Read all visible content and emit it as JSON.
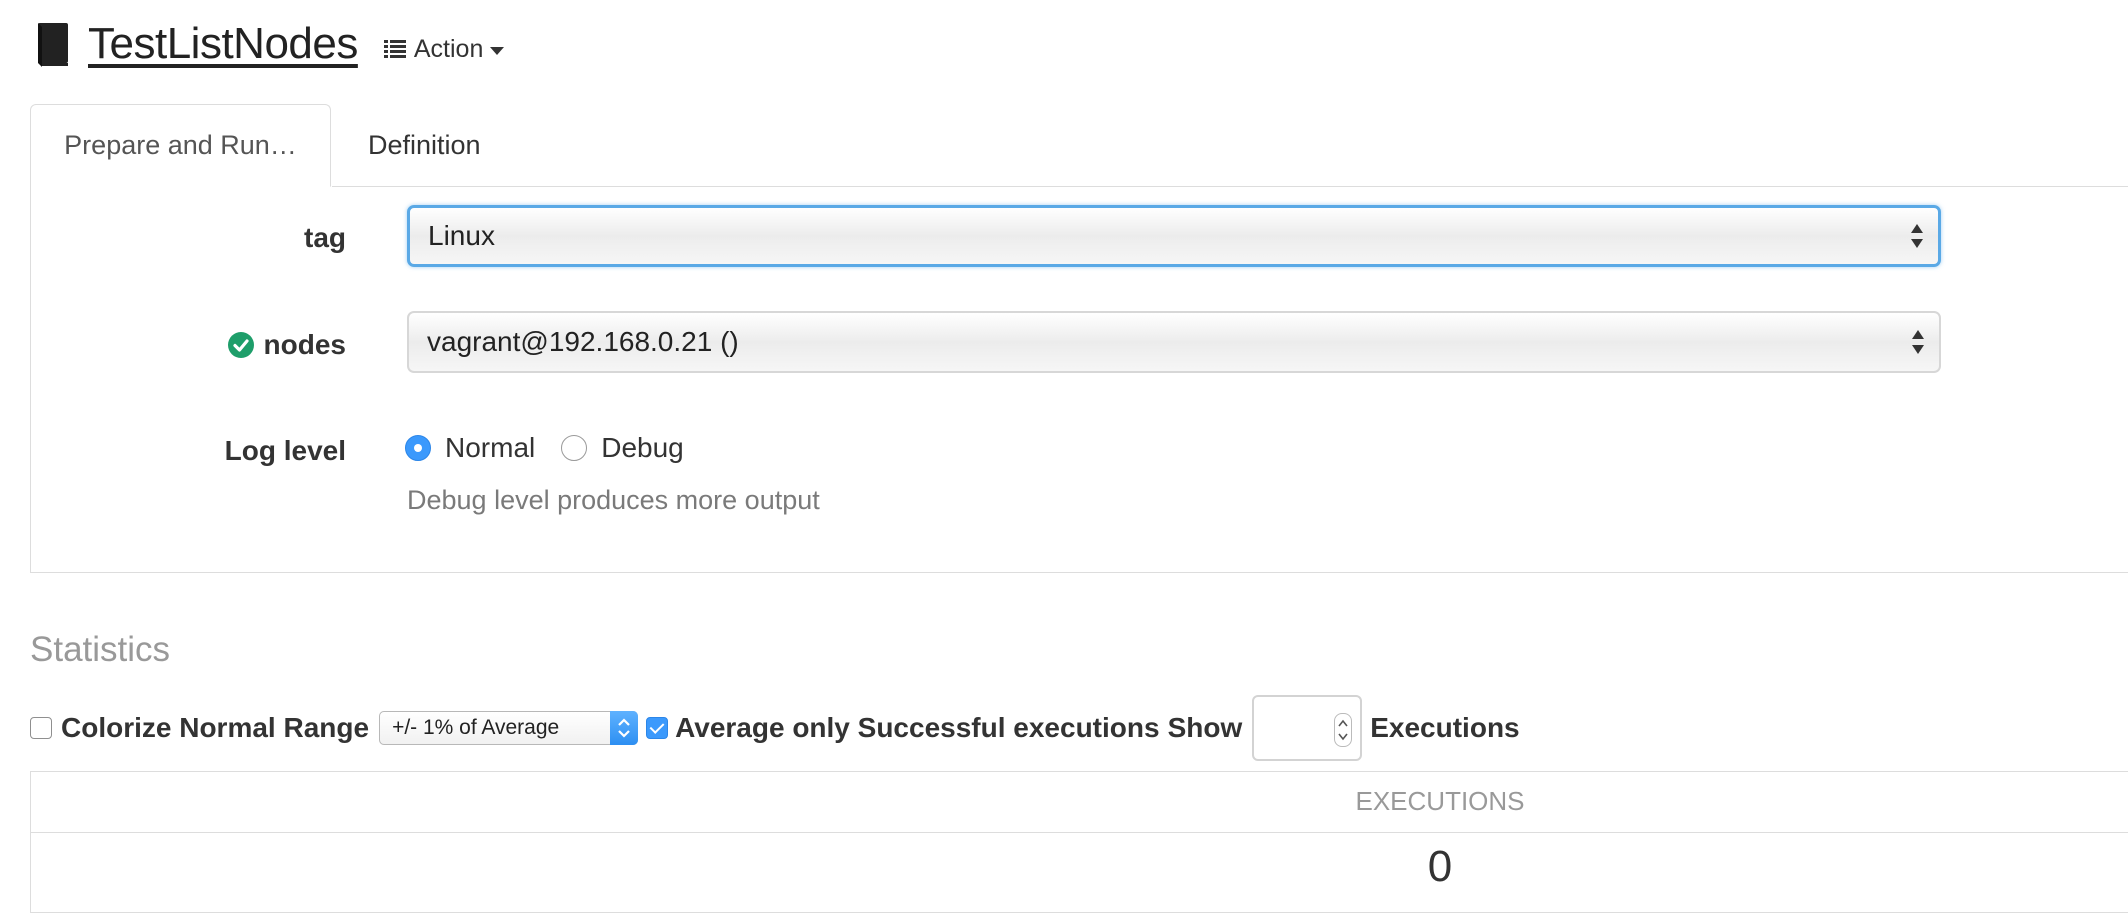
{
  "header": {
    "job_name": "TestListNodes",
    "action_label": "Action"
  },
  "tabs": [
    {
      "label": "Prepare and Run…",
      "active": true
    },
    {
      "label": "Definition",
      "active": false
    }
  ],
  "form": {
    "tag": {
      "label": "tag",
      "value": "Linux"
    },
    "nodes": {
      "label": "nodes",
      "value": "vagrant@192.168.0.21 ()",
      "status_icon": "check-circle-icon",
      "status_color": "#1e9e6a"
    },
    "log_level": {
      "label": "Log level",
      "options": [
        {
          "label": "Normal",
          "selected": true
        },
        {
          "label": "Debug",
          "selected": false
        }
      ],
      "help": "Debug level produces more output"
    }
  },
  "statistics": {
    "title": "Statistics",
    "colorize_label": "Colorize Normal Range",
    "colorize_checked": false,
    "range_value": "+/- 1% of Average",
    "avg_success_label": "Average only Successful executions",
    "avg_success_checked": true,
    "show_label": "Show",
    "show_count": "",
    "executions_label": "Executions",
    "table": {
      "header": "EXECUTIONS",
      "value": "0"
    }
  },
  "colors": {
    "accent": "#3b99fc",
    "focus_border": "#5aa9e6",
    "muted_text": "#999999"
  }
}
